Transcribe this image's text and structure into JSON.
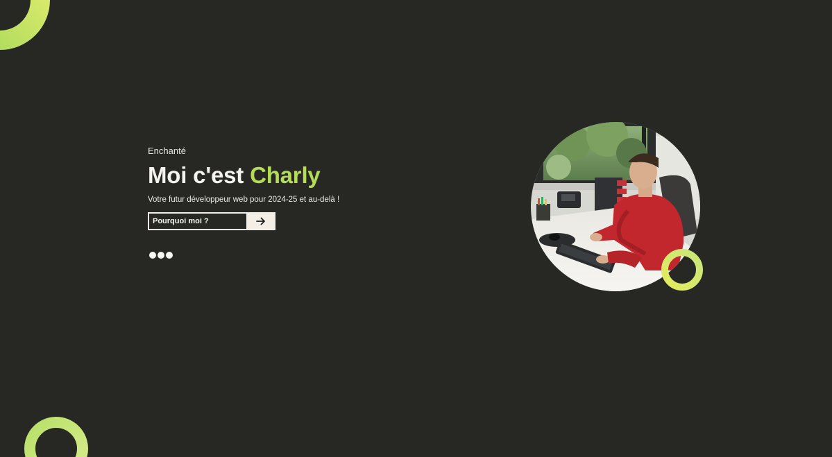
{
  "hero": {
    "greeting": "Enchanté",
    "headline_prefix": "Moi c'est ",
    "headline_name": "Charly",
    "tagline": "Votre futur développeur web pour 2024-25 et au-delà !",
    "cta_label": "Pourquoi moi ?",
    "cta_icon": "arrow-right-icon"
  },
  "pager": {
    "dot_count": 3
  },
  "portrait": {
    "description_icon": "portrait-photo"
  },
  "colors": {
    "background": "#272824",
    "accent": "#b5dc57",
    "text": "#f4f3ee",
    "button_fill": "#f3efe7",
    "ring_gradient_start": "#9fd457",
    "ring_gradient_end": "#e2ee6c"
  }
}
